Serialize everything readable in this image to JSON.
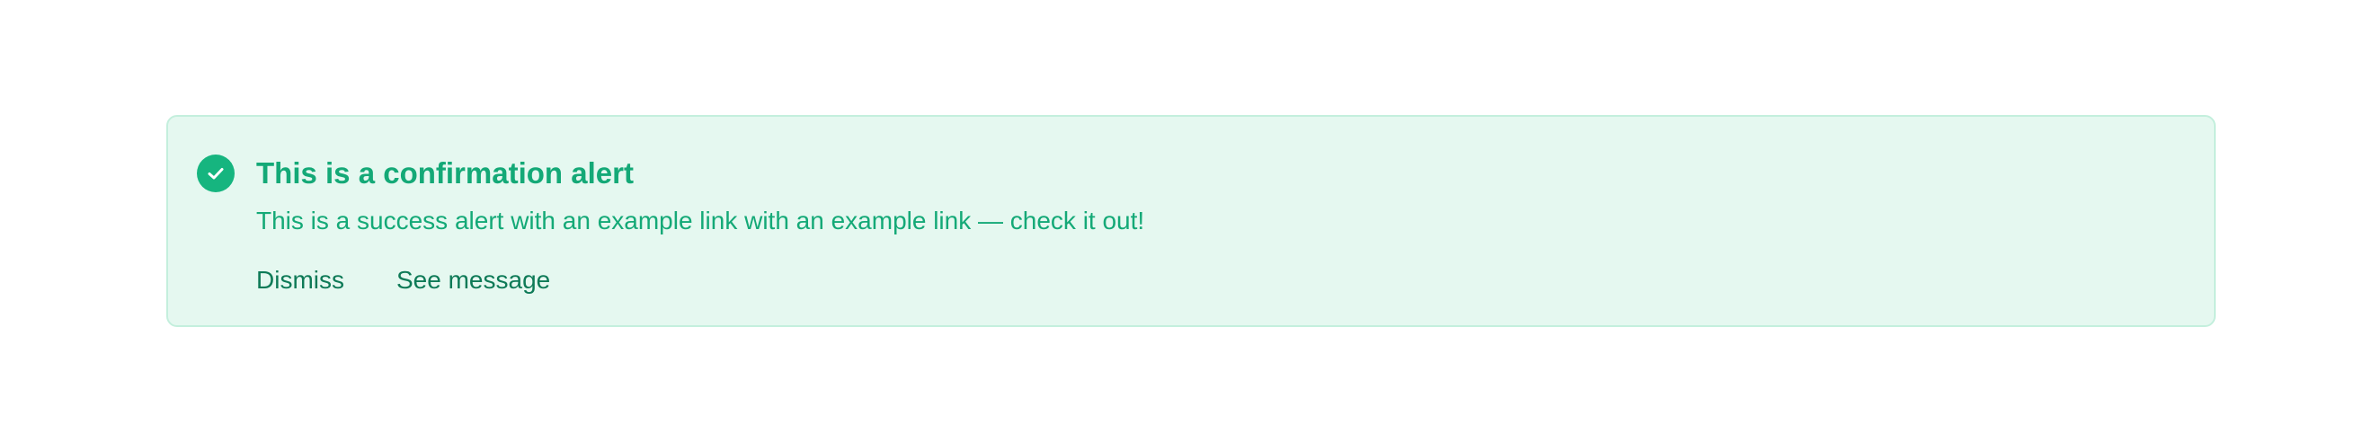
{
  "alert": {
    "icon": "check-circle-icon",
    "title": "This is a confirmation alert",
    "message": "This is a success alert with an example link with an example link — check it out!",
    "actions": {
      "dismiss_label": "Dismiss",
      "see_message_label": "See message"
    },
    "colors": {
      "background": "#e5f8f0",
      "border": "#c4efdd",
      "accent": "#16b57f",
      "text": "#14a977",
      "action_text": "#0e7a57"
    }
  }
}
